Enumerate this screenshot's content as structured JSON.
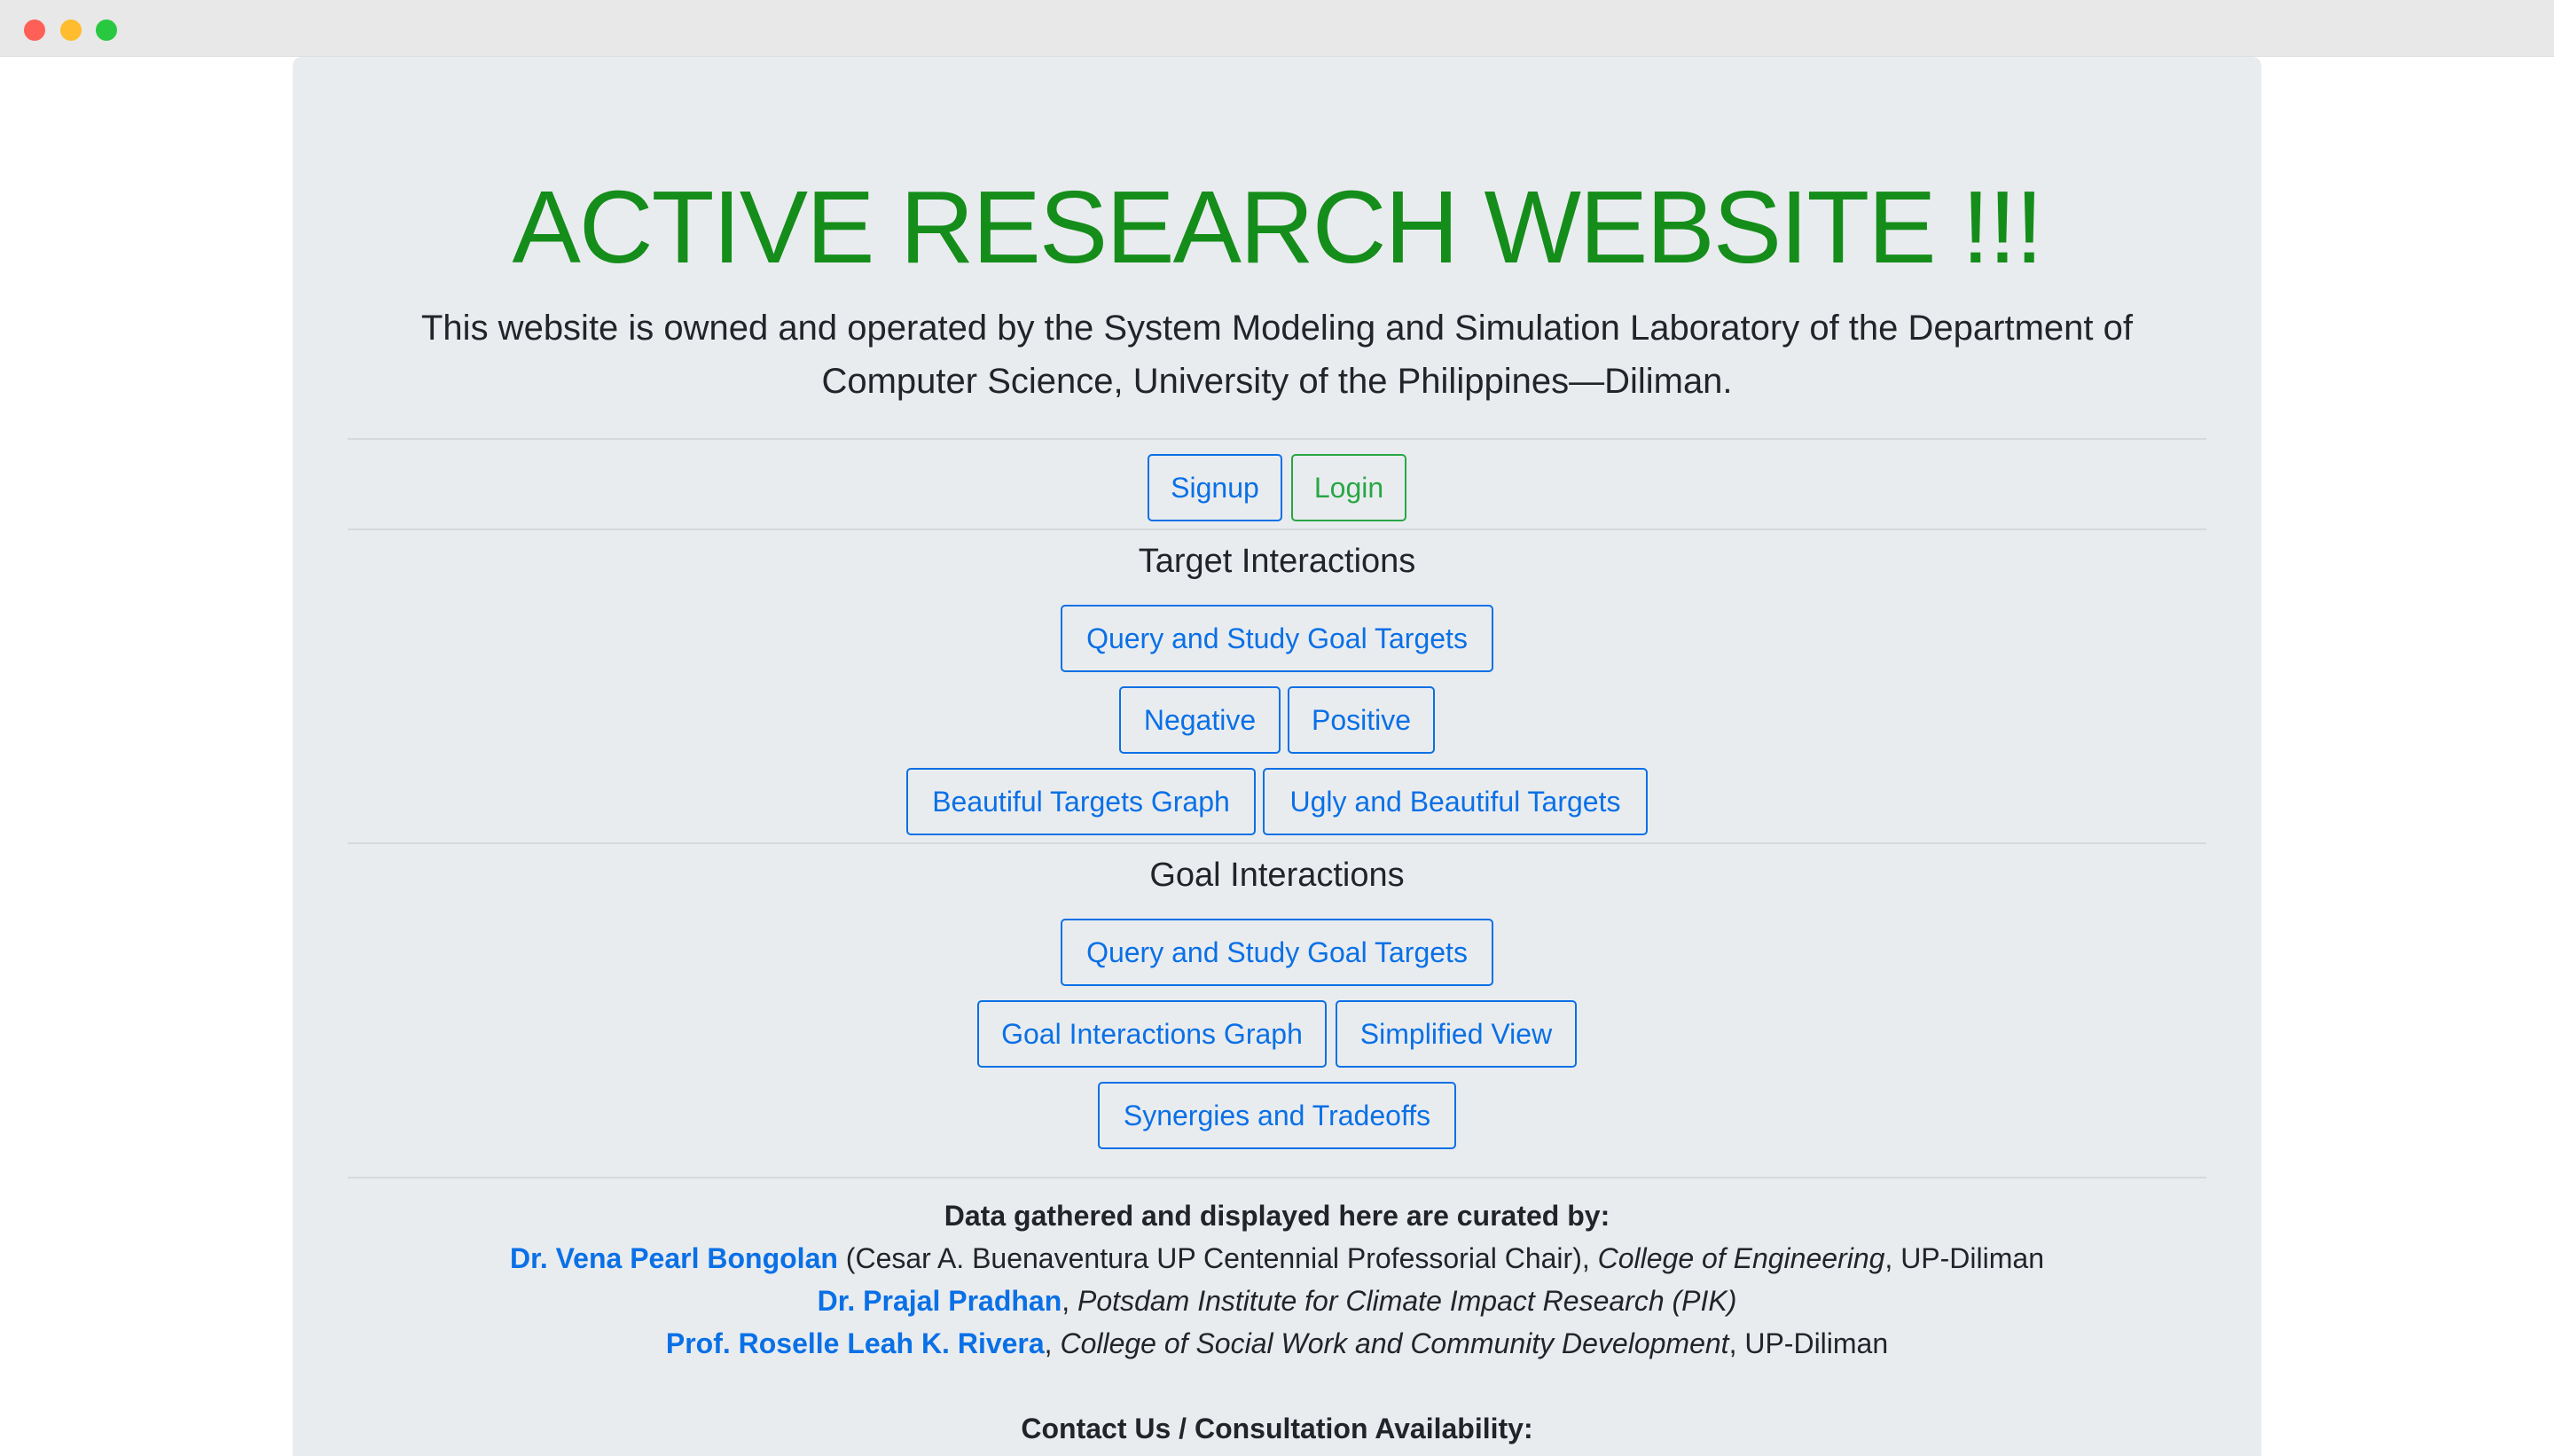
{
  "window": {
    "controls": [
      "close",
      "minimize",
      "maximize"
    ]
  },
  "hero": {
    "title": "ACTIVE RESEARCH WEBSITE !!!",
    "lead": "This website is owned and operated by the System Modeling and Simulation Laboratory of the Department of Computer Science, University of the Philippines—Diliman."
  },
  "auth": {
    "signup": "Signup",
    "login": "Login"
  },
  "target_interactions": {
    "title": "Target Interactions",
    "query": "Query and Study Goal Targets",
    "negative": "Negative",
    "positive": "Positive",
    "beautiful_graph": "Beautiful Targets Graph",
    "ugly_beautiful": "Ugly and Beautiful Targets"
  },
  "goal_interactions": {
    "title": "Goal Interactions",
    "query": "Query and Study Goal Targets",
    "graph": "Goal Interactions Graph",
    "simplified": "Simplified View",
    "synergies": "Synergies and Tradeoffs"
  },
  "credits": {
    "heading": "Data gathered and displayed here are curated by:",
    "people": [
      {
        "name": "Dr. Vena Pearl Bongolan",
        "plain1": " (Cesar A. Buenaventura UP Centennial Professorial Chair), ",
        "italic": "College of Engineering",
        "plain2": ", UP-Diliman"
      },
      {
        "name": "Dr. Prajal Pradhan",
        "plain1": ", ",
        "italic": "Potsdam Institute for Climate Impact Research (PIK)",
        "plain2": ""
      },
      {
        "name": "Prof. Roselle Leah K. Rivera",
        "plain1": ", ",
        "italic": "College of Social Work and Community Development",
        "plain2": ", UP-Diliman"
      }
    ],
    "contact_heading": "Contact Us / Consultation Availability:"
  },
  "colors": {
    "title_green": "#158d1a",
    "primary_blue": "#0a70e6",
    "success_green": "#28a745",
    "jumbotron_bg": "#e9ecef"
  }
}
